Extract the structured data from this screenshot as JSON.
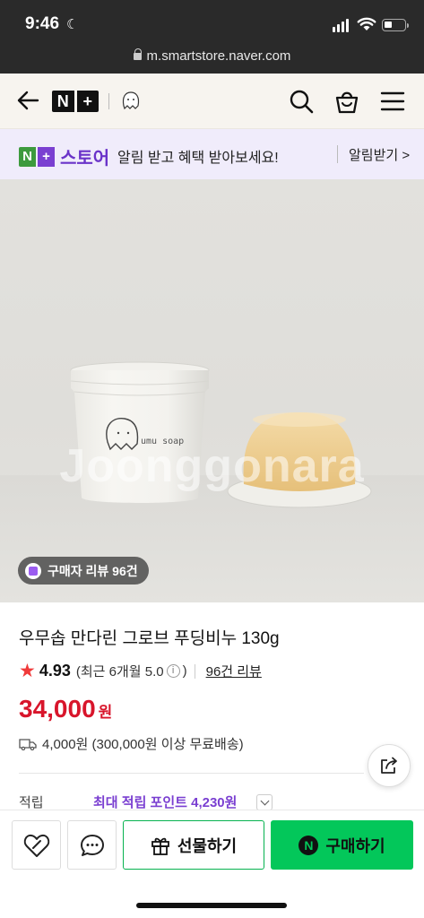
{
  "status_bar": {
    "time": "9:46"
  },
  "browser": {
    "url": "m.smartstore.naver.com"
  },
  "header": {
    "logo_left": "N",
    "logo_right": "+"
  },
  "banner": {
    "store_badge_left": "N",
    "store_badge_right": "+",
    "store_text": "스토어",
    "message": "알림 받고 혜택 받아보세요!",
    "link_label": "알림받기 >"
  },
  "hero": {
    "watermark": "Joonggonara",
    "cup_logo_text": "umu soap",
    "review_chip": "구매자 리뷰 96건"
  },
  "product": {
    "title": "우무솝 만다린 그로브 푸딩비누 130g",
    "rating": "4.93",
    "rating_recent": "(최근 6개월 5.0",
    "rating_recent_close": ")",
    "review_link": "96건 리뷰",
    "price": "34,000",
    "currency": "원",
    "shipping": "4,000원 (300,000원 이상 무료배송)",
    "points_label": "적립",
    "points_value": "최대 적립 포인트 4,230원"
  },
  "bottom_bar": {
    "gift_label": "선물하기",
    "buy_label": "구매하기",
    "buy_icon_letter": "N"
  },
  "colors": {
    "price": "#d8152b",
    "buy_button": "#03c75a",
    "store_purple": "#7a3fd1",
    "header_bg": "#f7f4ef"
  }
}
